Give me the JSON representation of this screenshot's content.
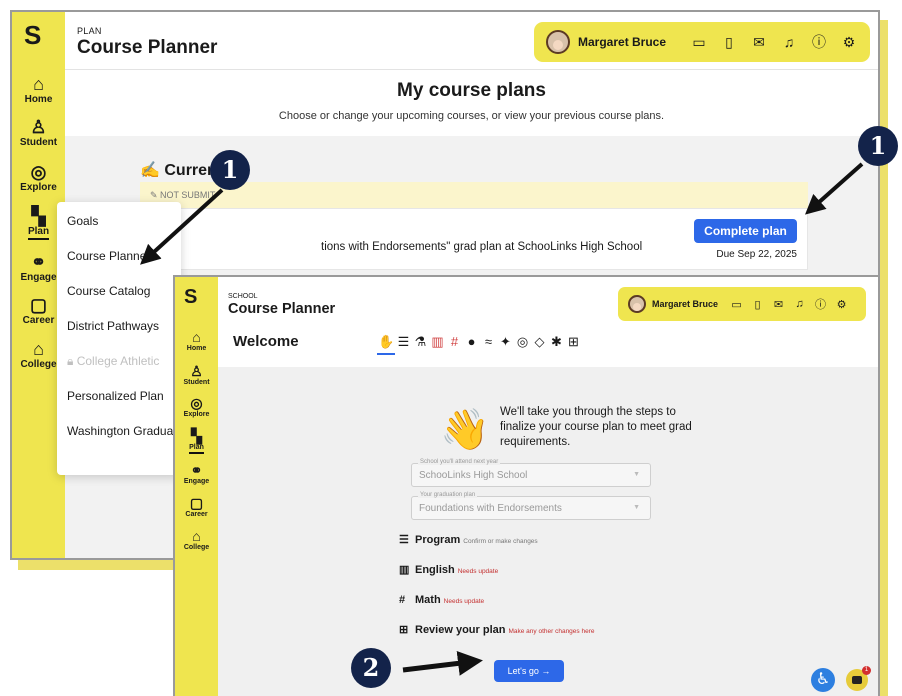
{
  "back_window": {
    "section_label": "PLAN",
    "title": "Course Planner",
    "user": {
      "name": "Margaret Bruce"
    },
    "header_icons": [
      "wallet-icon",
      "document-icon",
      "mail-icon",
      "bell-icon",
      "help-icon",
      "settings-icon"
    ],
    "page_heading": "My course plans",
    "page_subheading": "Choose or change your upcoming courses, or view your previous course plans.",
    "current_section": "✍ Curren",
    "not_submitted_label": "NOT SUBMIT",
    "plan_text": "tions with Endorsements\" grad plan at SchooLinks High School",
    "complete_button": "Complete plan",
    "due_date": "Due Sep 22, 2025",
    "nav": [
      {
        "label": "Home",
        "icon": "home-icon"
      },
      {
        "label": "Student",
        "icon": "student-icon"
      },
      {
        "label": "Explore",
        "icon": "compass-icon"
      },
      {
        "label": "Plan",
        "icon": "map-icon"
      },
      {
        "label": "Engage",
        "icon": "handshake-icon"
      },
      {
        "label": "Career",
        "icon": "briefcase-icon"
      },
      {
        "label": "College",
        "icon": "college-icon"
      }
    ],
    "plan_menu": [
      {
        "label": "Goals",
        "disabled": false
      },
      {
        "label": "Course Planner",
        "disabled": false
      },
      {
        "label": "Course Catalog",
        "disabled": false
      },
      {
        "label": "District Pathways",
        "disabled": false
      },
      {
        "label": "College Athletic",
        "disabled": true
      },
      {
        "label": "Personalized Plan",
        "disabled": false
      },
      {
        "label": "Washington Graduati",
        "disabled": false
      }
    ]
  },
  "front_window": {
    "section_label": "SCHOOL",
    "title": "Course Planner",
    "user": {
      "name": "Margaret Bruce"
    },
    "welcome": "Welcome",
    "intro": "We'll take you through the steps to finalize your course plan to meet grad requirements.",
    "fields": [
      {
        "label": "School you'll attend next year",
        "value": "SchooLinks High School"
      },
      {
        "label": "Your graduation plan",
        "value": "Foundations with Endorsements"
      }
    ],
    "steps": [
      {
        "title": "Program",
        "note": "Confirm or make changes",
        "status": "ok"
      },
      {
        "title": "English",
        "note": "Needs update",
        "status": "needs-update"
      },
      {
        "title": "Math",
        "note": "Needs update",
        "status": "needs-update"
      },
      {
        "title": "Review your plan",
        "note": "Make any other changes here",
        "status": "ok"
      }
    ],
    "go_button": "Let's go →",
    "chat_badge": "1",
    "step_icons": [
      "✋",
      "☰",
      "⚗",
      "▥",
      "#",
      "●",
      "≈",
      "✦",
      "◎",
      "◇",
      "✱",
      "⊞"
    ]
  },
  "annotations": {
    "callout_1": "1",
    "callout_1b": "1",
    "callout_2": "2"
  },
  "colors": {
    "accent_yellow": "#efe54f",
    "primary_blue": "#2d68e8",
    "callout_navy": "#13234a"
  }
}
